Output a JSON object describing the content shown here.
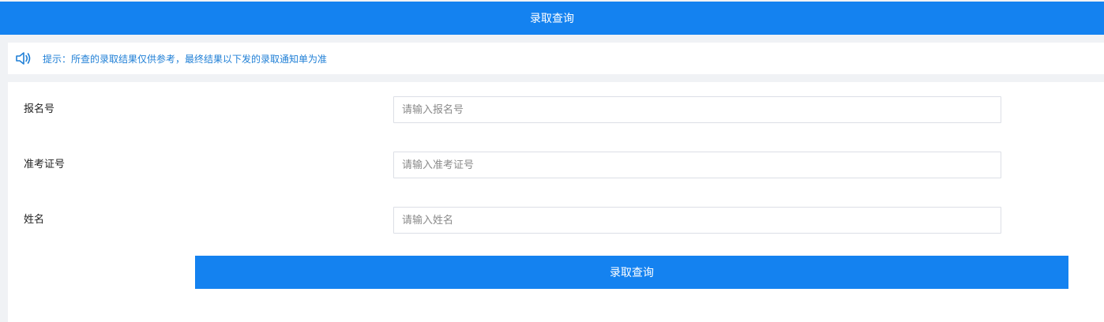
{
  "header": {
    "title": "录取查询"
  },
  "notice": {
    "icon": "speaker-icon",
    "text": "提示：所查的录取结果仅供参考，最终结果以下发的录取通知单为准"
  },
  "form": {
    "fields": [
      {
        "label": "报名号",
        "placeholder": "请输入报名号",
        "value": ""
      },
      {
        "label": "准考证号",
        "placeholder": "请输入准考证号",
        "value": ""
      },
      {
        "label": "姓名",
        "placeholder": "请输入姓名",
        "value": ""
      }
    ],
    "submit_label": "录取查询"
  },
  "colors": {
    "primary": "#1482f0",
    "notice_text": "#1f7fd6",
    "background": "#f0f2f5"
  }
}
